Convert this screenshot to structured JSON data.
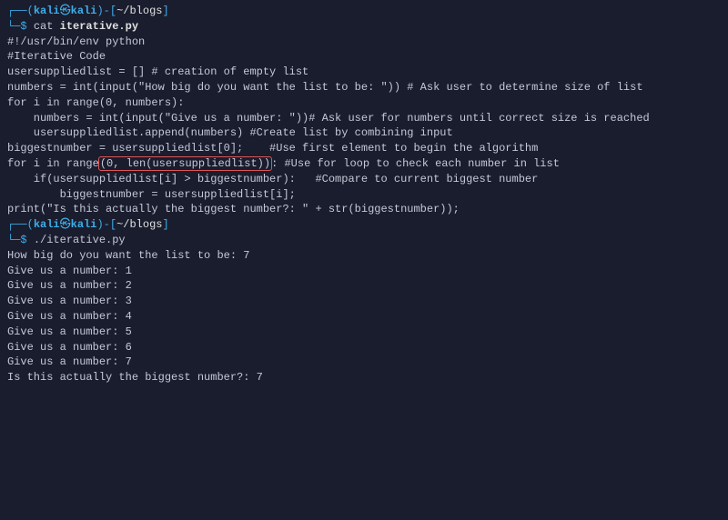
{
  "prompt1": {
    "user": "kali",
    "host": "kali",
    "path": "~/blogs",
    "cmd": "cat",
    "arg": "iterative.py"
  },
  "code": {
    "l1": "#!/usr/bin/env python",
    "l2": "#Iterative Code",
    "l3": "",
    "l4": "usersuppliedlist = [] # creation of empty list",
    "l5": "",
    "l6": "numbers = int(input(\"How big do you want the list to be: \")) # Ask user to determine size of list",
    "l7": "",
    "l8": "for i in range(0, numbers):",
    "l9": "    numbers = int(input(\"Give us a number: \"))# Ask user for numbers until correct size is reached",
    "l10": "",
    "l11": "    usersuppliedlist.append(numbers) #Create list by combining input",
    "l12": "",
    "l13": "",
    "l14": "",
    "l15": "biggestnumber = usersuppliedlist[0];    #Use first element to begin the algorithm",
    "l16": "",
    "l17a": "for i in range",
    "l17b": "(0, len(usersuppliedlist))",
    "l17c": ": #Use for loop to check each number in list",
    "l18": "    if(usersuppliedlist[i] > biggestnumber):   #Compare to current biggest number",
    "l19": "        biggestnumber = usersuppliedlist[i];",
    "l20": "",
    "l21": "print(\"Is this actually the biggest number?: \" + str(biggestnumber));",
    "l22": ""
  },
  "prompt2": {
    "user": "kali",
    "host": "kali",
    "path": "~/blogs",
    "cmd": "./iterative.py"
  },
  "output": {
    "l1": "How big do you want the list to be: 7",
    "l2": "Give us a number: 1",
    "l3": "Give us a number: 2",
    "l4": "Give us a number: 3",
    "l5": "Give us a number: 4",
    "l6": "Give us a number: 5",
    "l7": "Give us a number: 6",
    "l8": "Give us a number: 7",
    "l9": "Is this actually the biggest number?: 7"
  }
}
